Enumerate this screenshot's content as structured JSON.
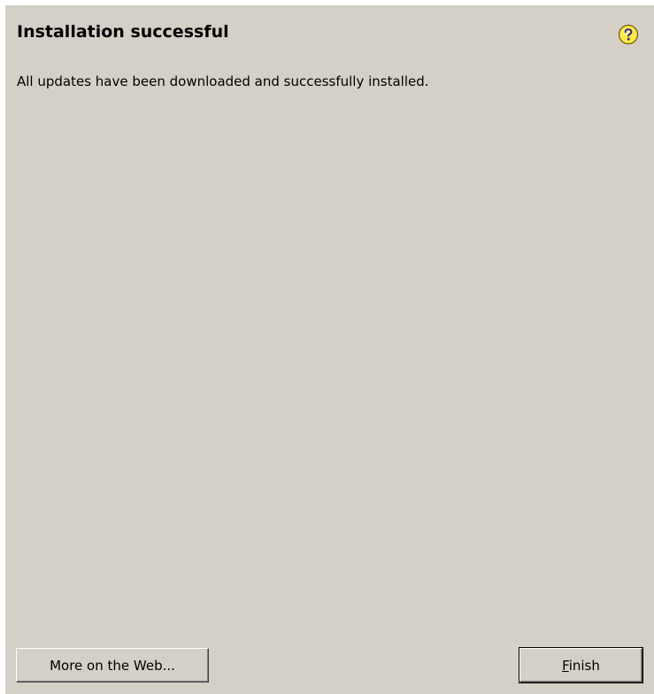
{
  "dialog": {
    "title": "Installation successful",
    "message": "All updates have been downloaded and successfully installed.",
    "help_icon": "help-question-icon",
    "buttons": {
      "more_on_web": "More on the Web...",
      "finish_mnemonic": "F",
      "finish_rest": "inish"
    }
  },
  "colors": {
    "dialog_background": "#d4d0c8",
    "help_icon_fill": "#ffe84a"
  }
}
